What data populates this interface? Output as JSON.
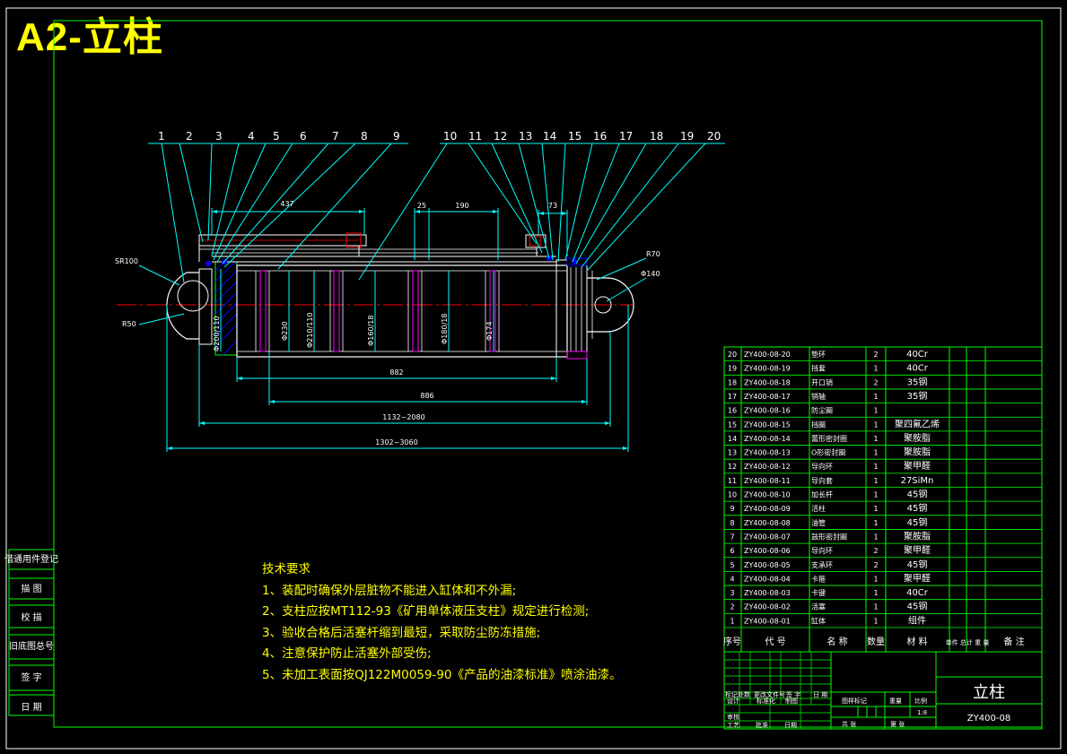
{
  "sheet_title": "A2-立柱",
  "balloons": [
    "1",
    "2",
    "3",
    "4",
    "5",
    "6",
    "7",
    "8",
    "9",
    "10",
    "11",
    "12",
    "13",
    "14",
    "15",
    "16",
    "17",
    "18",
    "19",
    "20"
  ],
  "dims": {
    "d437": "437",
    "d25": "25",
    "d190": "190",
    "d73": "73",
    "r70": "R70",
    "sr100": "SR100",
    "d140": "Φ140",
    "r50": "R50",
    "d200": "Φ200/110",
    "d230": "Φ230",
    "d210": "Φ210/110",
    "d160": "Φ160/18",
    "d180": "Φ180/18",
    "d174": "Φ174",
    "d882": "882",
    "d886": "886",
    "stroke": "1132~2080",
    "total": "1302~3060"
  },
  "tech_notes": {
    "title": "技术要求",
    "items": [
      "1、装配时确保外层脏物不能进入缸体和不外漏;",
      "2、支柱应按MT112-93《矿用单体液压支柱》规定进行检测;",
      "3、验收合格后活塞杆缩到最短，采取防尘防冻措施;",
      "4、注意保护防止活塞外部受伤;",
      "5、未加工表面按QJ122M0059-90《产品的油漆标准》喷涂油漆。"
    ]
  },
  "left_strip": [
    "借通用件登记",
    "描 图",
    "校 描",
    "旧底图总号",
    "签 字",
    "日 期"
  ],
  "bom": {
    "headers": [
      "序号",
      "代 号",
      "名 称",
      "数量",
      "材 料",
      "单件 总计 重 量",
      "备 注"
    ],
    "rows": [
      [
        "20",
        "ZY400-08-20",
        "垫环",
        "2",
        "40Cr"
      ],
      [
        "19",
        "ZY400-08-19",
        "挡套",
        "1",
        "40Cr"
      ],
      [
        "18",
        "ZY400-08-18",
        "开口销",
        "2",
        "35钢"
      ],
      [
        "17",
        "ZY400-08-17",
        "销轴",
        "1",
        "35钢"
      ],
      [
        "16",
        "ZY400-08-16",
        "防尘圈",
        "1",
        ""
      ],
      [
        "15",
        "ZY400-08-15",
        "挡圈",
        "1",
        "聚四氟乙烯"
      ],
      [
        "14",
        "ZY400-08-14",
        "蕾形密封圈",
        "1",
        "聚胺脂"
      ],
      [
        "13",
        "ZY400-08-13",
        "O形密封圈",
        "1",
        "聚胺脂"
      ],
      [
        "12",
        "ZY400-08-12",
        "导向环",
        "1",
        "聚甲醛"
      ],
      [
        "11",
        "ZY400-08-11",
        "导向套",
        "1",
        "27SiMn"
      ],
      [
        "10",
        "ZY400-08-10",
        "加长杆",
        "1",
        "45钢"
      ],
      [
        "9",
        "ZY400-08-09",
        "活柱",
        "1",
        "45钢"
      ],
      [
        "8",
        "ZY400-08-08",
        "油管",
        "1",
        "45钢"
      ],
      [
        "7",
        "ZY400-08-07",
        "鼓形密封圈",
        "1",
        "聚胺脂"
      ],
      [
        "6",
        "ZY400-08-06",
        "导向环",
        "2",
        "聚甲醛"
      ],
      [
        "5",
        "ZY400-08-05",
        "支承环",
        "2",
        "45钢"
      ],
      [
        "4",
        "ZY400-08-04",
        "卡箍",
        "1",
        "聚甲醛"
      ],
      [
        "3",
        "ZY400-08-03",
        "卡键",
        "1",
        "40Cr"
      ],
      [
        "2",
        "ZY400-08-02",
        "活塞",
        "1",
        "45钢"
      ],
      [
        "1",
        "ZY400-08-01",
        "缸体",
        "1",
        "组件"
      ]
    ]
  },
  "title_block": {
    "name": "立柱",
    "code": "ZY400-08",
    "scale": "1:8",
    "labels": {
      "marks": "标记处数",
      "change_no": "更改文件号",
      "sign": "签 字",
      "date": "日 期",
      "design": "设计",
      "std": "标准化",
      "draw": "制图",
      "check": "审核",
      "process": "工艺",
      "approve": "批准",
      "date2": "日期",
      "stage": "图样标记",
      "weight": "重量",
      "ratio": "比例",
      "total": "共 张",
      "page": "第 张"
    }
  }
}
